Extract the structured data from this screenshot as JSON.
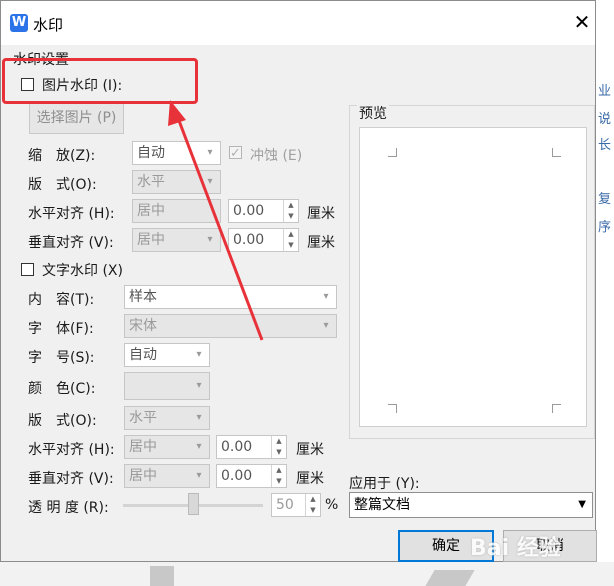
{
  "dialog": {
    "title": "水印",
    "app_icon_letter": "W",
    "close_glyph": "✕"
  },
  "group_title": "水印设置",
  "picture_watermark": {
    "checkbox_label": "图片水印 (I):",
    "select_button": "选择图片 (P)",
    "scale_label": "缩　放(Z):",
    "scale_value": "自动",
    "washout_label": "冲蚀 (E)",
    "layout_label": "版　式(O):",
    "layout_value": "水平",
    "h_align_label": "水平对齐 (H):",
    "h_align_value": "居中",
    "h_offset": "0.00",
    "v_align_label": "垂直对齐 (V):",
    "v_align_value": "居中",
    "v_offset": "0.00",
    "unit": "厘米"
  },
  "text_watermark": {
    "checkbox_label": "文字水印 (X)",
    "content_label": "内　容(T):",
    "content_value": "样本",
    "font_label": "字　体(F):",
    "font_value": "宋体",
    "size_label": "字　号(S):",
    "size_value": "自动",
    "color_label": "颜　色(C):",
    "layout_label": "版　式(O):",
    "layout_value": "水平",
    "h_align_label": "水平对齐 (H):",
    "h_align_value": "居中",
    "h_offset": "0.00",
    "v_align_label": "垂直对齐 (V):",
    "v_align_value": "居中",
    "v_offset": "0.00",
    "unit": "厘米",
    "transparency_label": "透 明 度 (R):",
    "transparency_value": "50",
    "transparency_unit": "%",
    "transparency_fraction": 0.5
  },
  "preview": {
    "title": "预览"
  },
  "apply": {
    "label": "应用于 (Y):",
    "value": "整篇文档"
  },
  "buttons": {
    "ok": "确定",
    "cancel": "取消"
  },
  "background_text": [
    "业",
    "说",
    "长",
    "复",
    "序"
  ],
  "watermark_overlay": "Bai 经验",
  "colors": {
    "highlight": "#e8323a",
    "accent": "#0078d7",
    "app_icon": "#2b73e8"
  }
}
